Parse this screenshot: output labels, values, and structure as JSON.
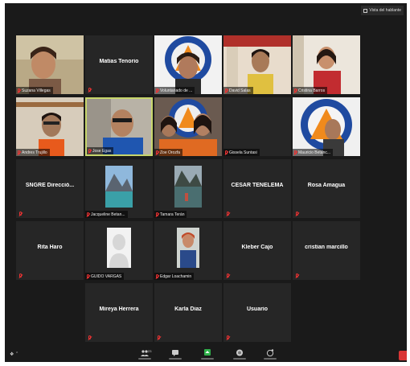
{
  "topbar": {
    "view_label": "Vista del hablante"
  },
  "toolbar": {
    "participants_count": "23"
  },
  "tiles": {
    "r1": [
      {
        "name": "Suzana Villegas"
      },
      {
        "name": "Matias Tenorio"
      },
      {
        "name": "Voluntariado de ..."
      },
      {
        "name": "David Salas"
      },
      {
        "name": "Cristina Barros"
      }
    ],
    "r2": [
      {
        "name": "Andres Trujillo"
      },
      {
        "name": "Jose Egas"
      },
      {
        "name": "Zoe Orozfa"
      },
      {
        "name": "Gissela Suntasi"
      },
      {
        "name": "Mauricio Betanc..."
      }
    ],
    "r3": [
      {
        "name": "SNGRE Direcció..."
      },
      {
        "name": "Jacqueline Betan..."
      },
      {
        "name": "Tamara Terán"
      },
      {
        "name": "CESAR TENELEMA"
      },
      {
        "name": "Rosa Amagua"
      }
    ],
    "r4": [
      {
        "name": "Rita Haro"
      },
      {
        "name": "GUIDO VARGAS"
      },
      {
        "name": "Edgar Loachamin"
      },
      {
        "name": "Kleber Cajo"
      },
      {
        "name": "cristian marcillo"
      }
    ],
    "r5": [
      {
        "name": "Mireya Herrera"
      },
      {
        "name": "Karla Diaz"
      },
      {
        "name": "Usuario"
      }
    ]
  }
}
